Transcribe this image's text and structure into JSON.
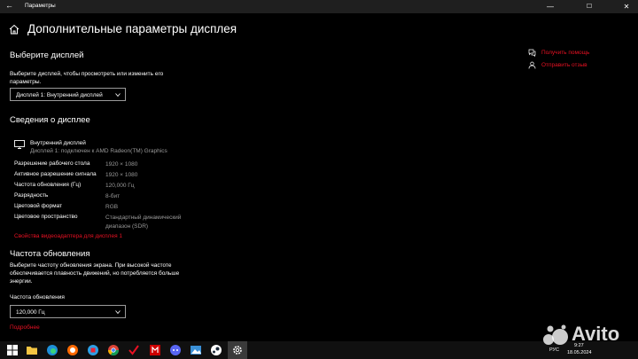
{
  "window": {
    "title": "Параметры",
    "back_glyph": "←",
    "minimize_glyph": "—",
    "maximize_glyph": "☐",
    "close_glyph": "✕"
  },
  "page": {
    "title": "Дополнительные параметры дисплея"
  },
  "select_display": {
    "heading": "Выберите дисплей",
    "description_line1": "Выберите дисплей, чтобы просмотреть или изменить его",
    "description_line2": "параметры.",
    "dropdown_value": "Дисплей 1: Внутренний дисплей"
  },
  "display_info": {
    "heading": "Сведения о дисплее",
    "monitor_name": "Внутренний дисплей",
    "monitor_connection": "Дисплей 1: подключен к AMD Radeon(TM) Graphics",
    "rows": [
      {
        "label": "Разрешение рабочего стола",
        "value": "1920 × 1080"
      },
      {
        "label": "Активное разрешение сигнала",
        "value": "1920 × 1080"
      },
      {
        "label": "Частота обновления (Гц)",
        "value": "120,000 Гц"
      },
      {
        "label": "Разрядность",
        "value": "8-бит"
      },
      {
        "label": "Цветовой формат",
        "value": "RGB"
      },
      {
        "label": "Цветовое пространство",
        "value": "Стандартный динамический диапазон (SDR)"
      }
    ],
    "adapter_link": "Свойства видеоадаптера для дисплея 1"
  },
  "refresh_rate": {
    "heading": "Частота обновления",
    "description_line1": "Выберите частоту обновления экрана. При высокой частоте",
    "description_line2": "обеспечивается плавность движений, но потребляется больше",
    "description_line3": "энергии.",
    "dropdown_label": "Частота обновления",
    "dropdown_value": "120,000 Гц",
    "more_link": "Подробнее"
  },
  "side_links": {
    "help": "Получить помощь",
    "feedback": "Отправить отзыв"
  },
  "taskbar": {
    "language": "РУС",
    "time": "9:27",
    "date": "18.05.2024"
  },
  "watermark": {
    "text": "Avito"
  },
  "colors": {
    "background": "#000000",
    "accent_link": "#e81123",
    "secondary_text": "#9a9a9a",
    "titlebar": "#1f1f1f",
    "taskbar": "#101010"
  }
}
